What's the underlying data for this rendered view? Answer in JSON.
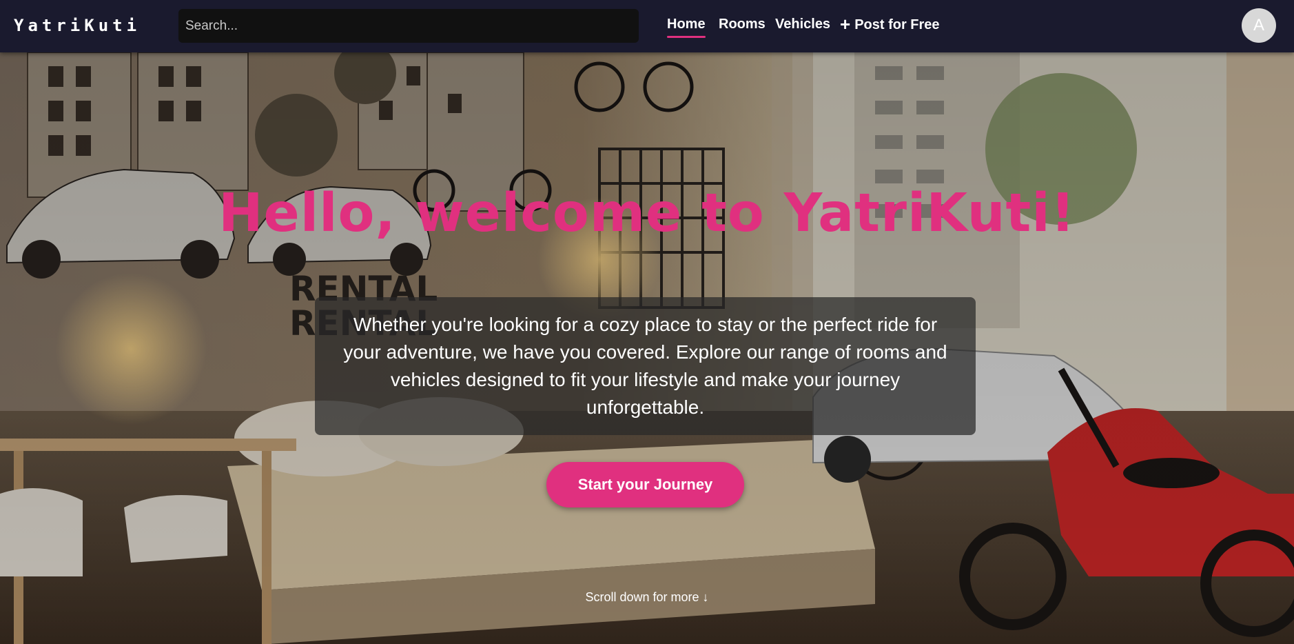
{
  "navbar": {
    "logo": "YatriKuti",
    "search_placeholder": "Search...",
    "links": [
      {
        "label": "Home",
        "active": true
      },
      {
        "label": "Rooms",
        "active": false
      },
      {
        "label": "Vehicles",
        "active": false
      },
      {
        "label": "Post for Free",
        "icon": "plus-icon",
        "active": false
      }
    ],
    "avatar_initial": "A"
  },
  "hero": {
    "title": "Hello, welcome to YatriKuti!",
    "description": "Whether you're looking for a cozy place to stay or the perfect ride for your adventure, we have you covered. Explore our range of rooms and vehicles designed to fit your lifestyle and make your journey unforgettable.",
    "cta_label": "Start your Journey",
    "scroll_hint": "Scroll down for more ↓"
  },
  "colors": {
    "navbar_bg": "#1a1a2e",
    "accent": "#e0307f",
    "search_bg": "#111111",
    "avatar_bg": "#d8d8d8"
  }
}
